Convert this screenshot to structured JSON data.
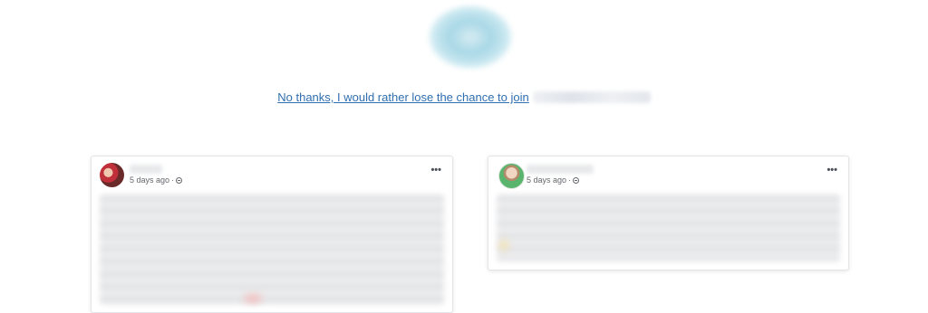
{
  "decline_link": {
    "text": "No thanks, I would rather lose the chance to join"
  },
  "posts": [
    {
      "time": "5 days ago",
      "separator": "·",
      "more_label": "•••"
    },
    {
      "time": "5 days ago",
      "separator": "·",
      "more_label": "•••"
    }
  ],
  "icons": {
    "logo": "blurred-logo",
    "privacy": "globe-icon",
    "more": "more-options-icon"
  },
  "colors": {
    "link": "#2f6fb0",
    "meta_text": "#65676b"
  }
}
